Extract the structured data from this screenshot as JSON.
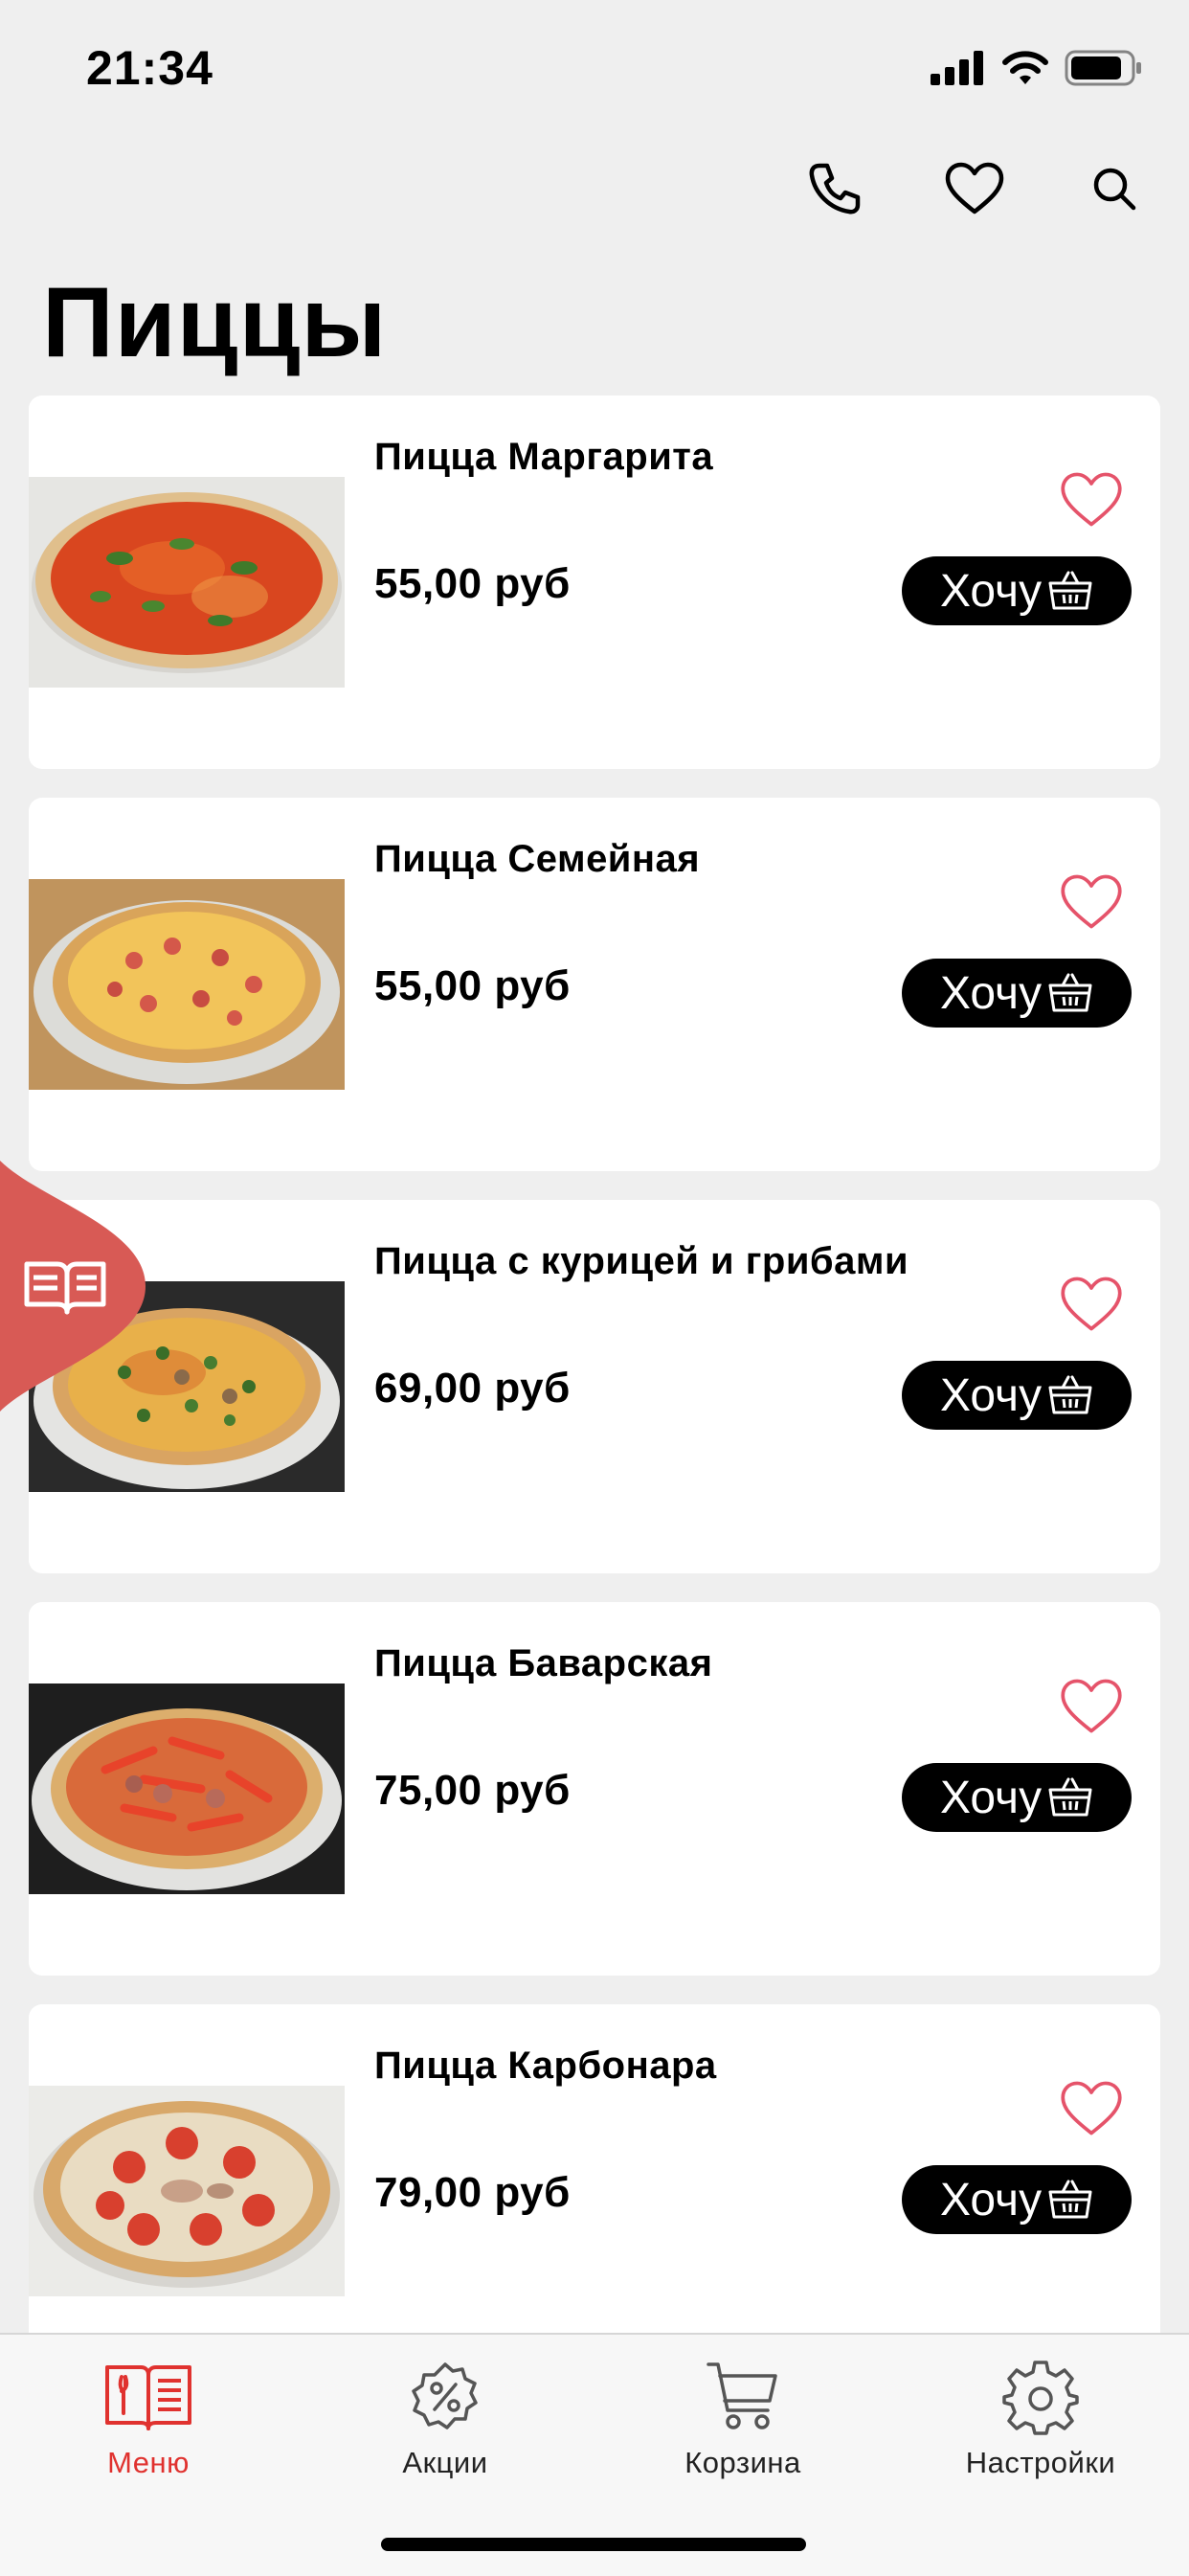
{
  "status_bar": {
    "time": "21:34",
    "icons": [
      "signal-icon",
      "wifi-icon",
      "battery-icon"
    ]
  },
  "header": {
    "actions": [
      "phone-icon",
      "heart-icon",
      "search-icon"
    ]
  },
  "page": {
    "title": "Пиццы"
  },
  "products": [
    {
      "name": "Пицца Маргарита",
      "price": "55,00 руб",
      "button": "Хочу",
      "photo": "margherita"
    },
    {
      "name": "Пицца Семейная",
      "price": "55,00 руб",
      "button": "Хочу",
      "photo": "family"
    },
    {
      "name": "Пицца с курицей и грибами",
      "price": "69,00 руб",
      "button": "Хочу",
      "photo": "chicken-mushroom"
    },
    {
      "name": "Пицца Баварская",
      "price": "75,00 руб",
      "button": "Хочу",
      "photo": "bavarian"
    },
    {
      "name": "Пицца Карбонара",
      "price": "79,00 руб",
      "button": "Хочу",
      "photo": "carbonara"
    }
  ],
  "side_tab": {
    "icon": "menu-book-icon"
  },
  "tab_bar": {
    "items": [
      {
        "label": "Меню",
        "icon": "menu-book-icon",
        "active": true
      },
      {
        "label": "Акции",
        "icon": "discount-icon",
        "active": false
      },
      {
        "label": "Корзина",
        "icon": "cart-icon",
        "active": false
      },
      {
        "label": "Настройки",
        "icon": "gear-icon",
        "active": false
      }
    ]
  },
  "colors": {
    "accent": "#e0322f",
    "fav_outline": "#e5536a",
    "side_tab": "#d85a55",
    "button": "#000000",
    "background": "#efefef"
  }
}
